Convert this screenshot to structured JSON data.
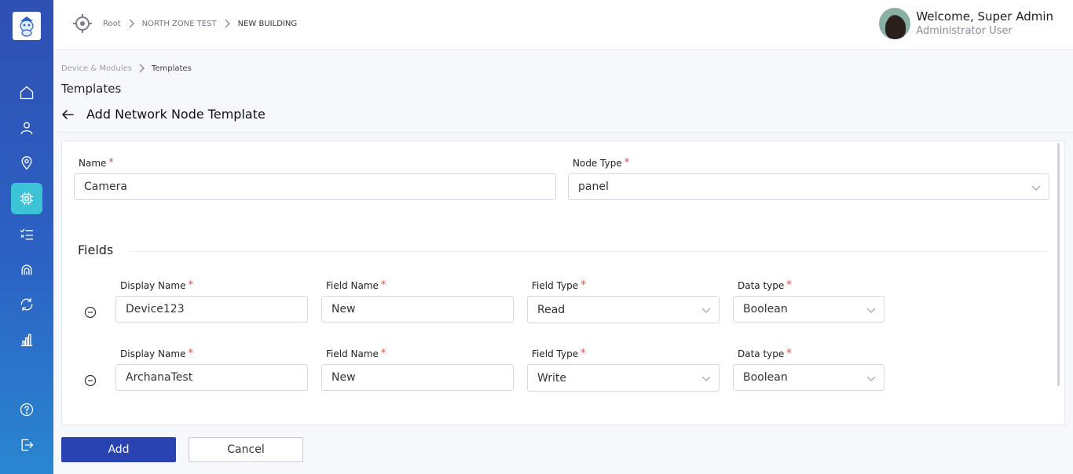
{
  "topbar": {
    "breadcrumb": [
      "Root",
      "NORTH ZONE TEST",
      "NEW BUILDING"
    ],
    "user": {
      "welcome": "Welcome, Super Admin",
      "role": "Administrator User"
    }
  },
  "sidebar": {
    "items": [
      {
        "name": "home",
        "icon": "home-icon",
        "active": false
      },
      {
        "name": "users",
        "icon": "user-icon",
        "active": false
      },
      {
        "name": "locations",
        "icon": "map-pin-icon",
        "active": false
      },
      {
        "name": "devices",
        "icon": "chip-icon",
        "active": true
      },
      {
        "name": "tasks",
        "icon": "checklist-icon",
        "active": false
      },
      {
        "name": "network",
        "icon": "signal-icon",
        "active": false
      },
      {
        "name": "sync",
        "icon": "refresh-icon",
        "active": false
      },
      {
        "name": "reports",
        "icon": "bar-chart-icon",
        "active": false
      },
      {
        "name": "help",
        "icon": "help-icon",
        "active": false
      },
      {
        "name": "logout",
        "icon": "logout-icon",
        "active": false
      }
    ]
  },
  "page": {
    "breadcrumb": [
      "Device & Modules",
      "Templates"
    ],
    "title": "Templates",
    "form_title": "Add Network Node Template"
  },
  "form": {
    "name_label": "Name",
    "name_value": "Camera",
    "node_type_label": "Node Type",
    "node_type_value": "panel",
    "fields_section": "Fields",
    "rows": [
      {
        "display_name_label": "Display Name",
        "display_name": "Device123",
        "field_name_label": "Field Name",
        "field_name": "New",
        "field_type_label": "Field Type",
        "field_type": "Read",
        "data_type_label": "Data type",
        "data_type": "Boolean"
      },
      {
        "display_name_label": "Display Name",
        "display_name": "ArchanaTest",
        "field_name_label": "Field Name",
        "field_name": "New",
        "field_type_label": "Field Type",
        "field_type": "Write",
        "data_type_label": "Data type",
        "data_type": "Boolean"
      }
    ],
    "required_marker": "*"
  },
  "actions": {
    "add": "Add",
    "cancel": "Cancel"
  },
  "colors": {
    "sidebar": "#2f4fb3",
    "active_nav": "#3cc3d6",
    "primary_button": "#2a43b3",
    "required": "#e04a4a"
  }
}
